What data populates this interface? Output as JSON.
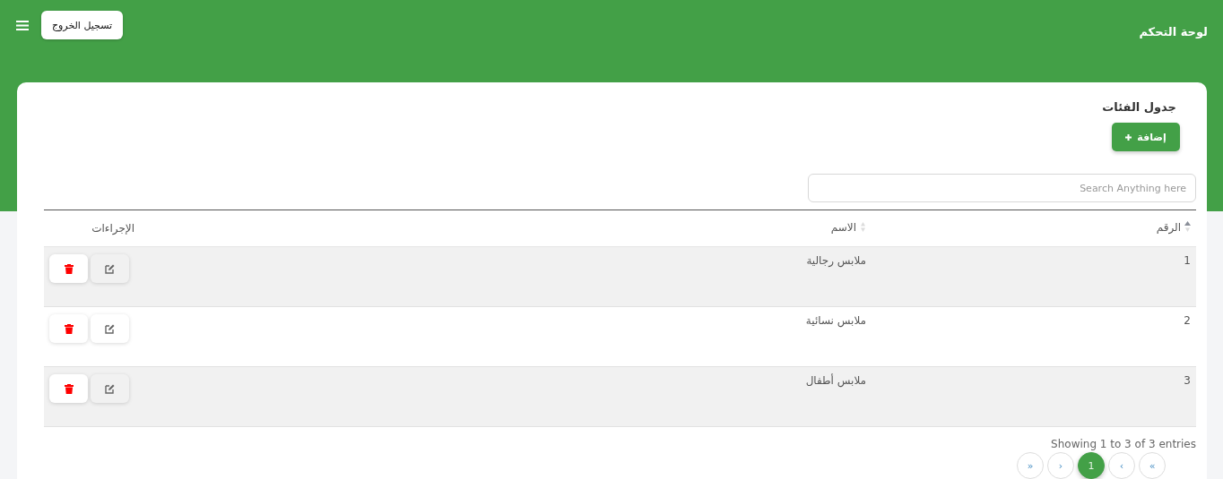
{
  "header": {
    "title": "لوحة التحكم",
    "logout_button": "تسجيل الخروج"
  },
  "card": {
    "title": "جدول الفئات",
    "add_button": "إضافة",
    "search": {
      "placeholder": "Search Anything here"
    }
  },
  "table": {
    "columns": [
      {
        "label": "الرقم",
        "sortable": true,
        "sorted": true
      },
      {
        "label": "الاسم",
        "sortable": true,
        "sorted": false
      },
      {
        "label": "الإجراءات",
        "sortable": false
      }
    ],
    "rows": [
      {
        "number": "1",
        "name": "ملابس رجالية"
      },
      {
        "number": "2",
        "name": "ملابس نسائية"
      },
      {
        "number": "3",
        "name": "ملابس أطفال"
      }
    ]
  },
  "footer": {
    "info": "Showing 1 to 3 of 3 entries",
    "pages": [
      {
        "label": "»",
        "selected": false
      },
      {
        "label": "›",
        "selected": false
      },
      {
        "label": "1",
        "selected": true
      },
      {
        "label": "‹",
        "selected": false
      },
      {
        "label": "«",
        "selected": false
      }
    ]
  }
}
